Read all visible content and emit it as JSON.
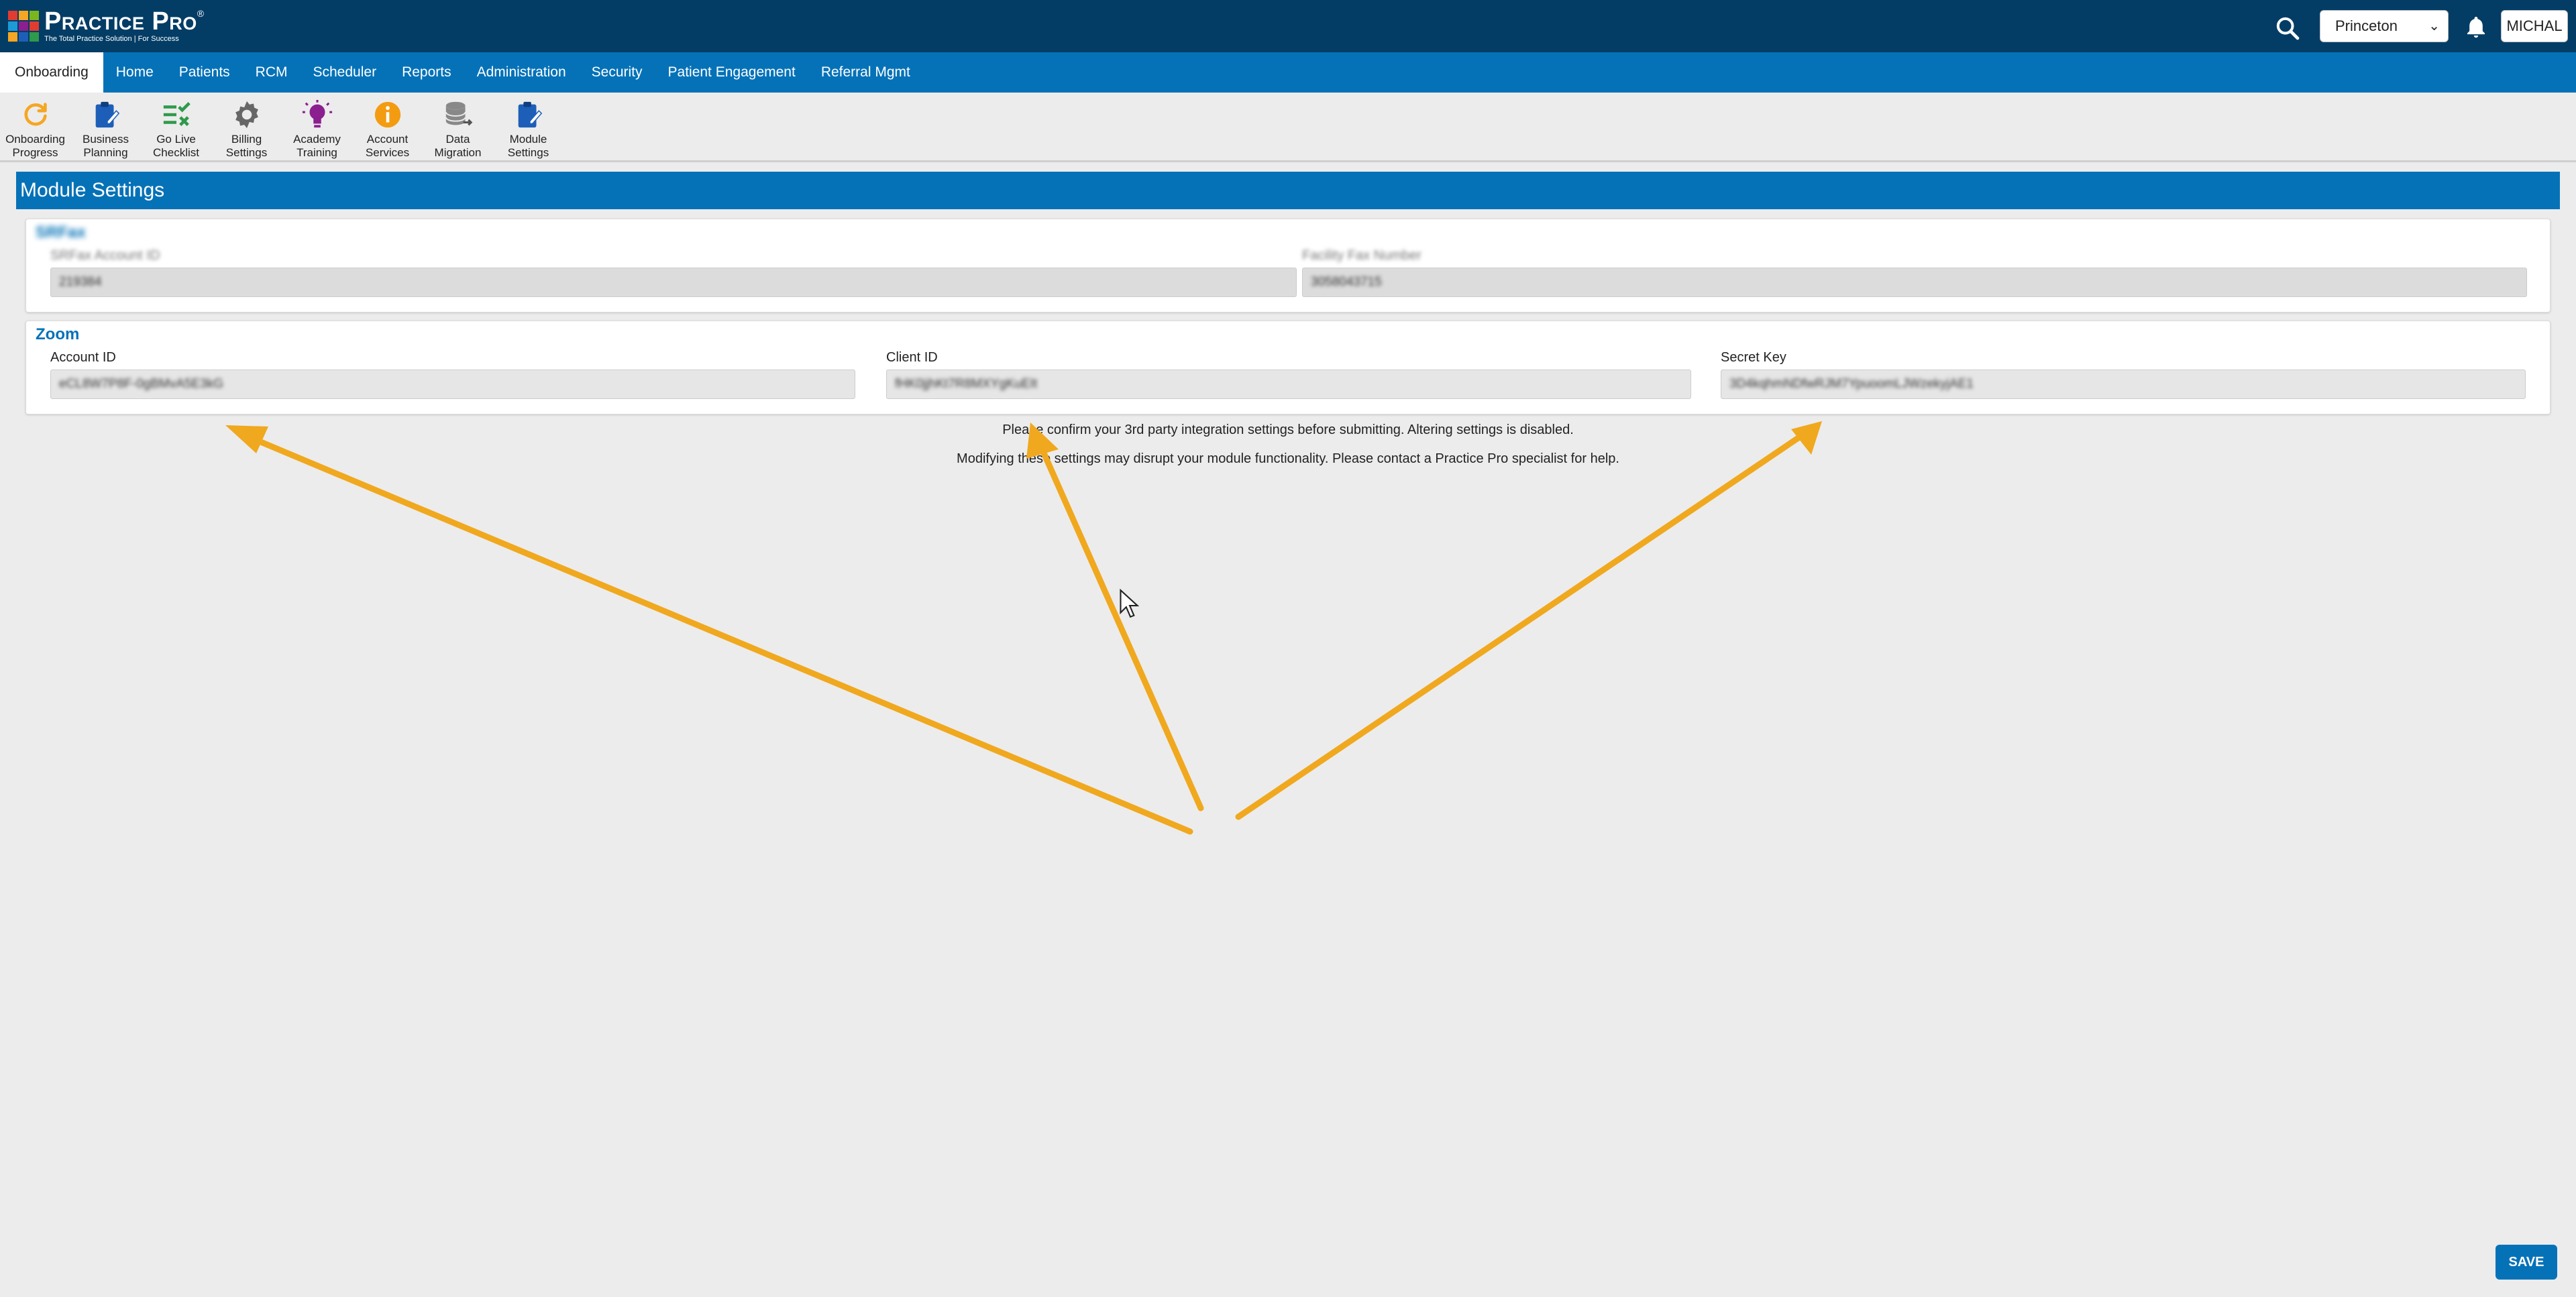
{
  "header": {
    "logo_title": "Practice Pro",
    "logo_trademark": "®",
    "logo_subtitle": "The Total Practice Solution | For Success",
    "location": "Princeton",
    "user": "MICHAL",
    "icons": {
      "search": "search-icon",
      "notifications": "bell-icon",
      "dropdown": "chevron-down-icon"
    }
  },
  "nav": {
    "items": [
      {
        "label": "Onboarding",
        "active": true
      },
      {
        "label": "Home"
      },
      {
        "label": "Patients"
      },
      {
        "label": "RCM"
      },
      {
        "label": "Scheduler"
      },
      {
        "label": "Reports"
      },
      {
        "label": "Administration"
      },
      {
        "label": "Security"
      },
      {
        "label": "Patient Engagement"
      },
      {
        "label": "Referral Mgmt"
      }
    ]
  },
  "subnav": {
    "items": [
      {
        "label1": "Onboarding",
        "label2": "Progress",
        "icon": "refresh-icon",
        "color": "#f5a623"
      },
      {
        "label1": "Business",
        "label2": "Planning",
        "icon": "clipboard-edit-icon",
        "color": "#1d5fb8"
      },
      {
        "label1": "Go Live",
        "label2": "Checklist",
        "icon": "checklist-icon",
        "color": "#2e9a4b"
      },
      {
        "label1": "Billing",
        "label2": "Settings",
        "icon": "gear-icon",
        "color": "#666666"
      },
      {
        "label1": "Academy",
        "label2": "Training",
        "icon": "lightbulb-icon",
        "color": "#8b1f8f"
      },
      {
        "label1": "Account",
        "label2": "Services",
        "icon": "info-icon",
        "color": "#f39c12"
      },
      {
        "label1": "Data",
        "label2": "Migration",
        "icon": "database-icon",
        "color": "#888888"
      },
      {
        "label1": "Module",
        "label2": "Settings",
        "icon": "clipboard-edit-icon",
        "color": "#1d5fb8"
      }
    ]
  },
  "page": {
    "title": "Module Settings"
  },
  "fax_card": {
    "title": "SRFax",
    "account_label": "SRFax Account ID",
    "account_value": "219384",
    "number_label": "Facility Fax Number",
    "number_value": "3058043715"
  },
  "zoom_card": {
    "title": "Zoom",
    "account_label": "Account ID",
    "account_value": "eCL8W7P8F-0gBMvA5E3kG",
    "client_label": "Client ID",
    "client_value": "fHK0jjhKt7R8MXYgKuEIt",
    "secret_label": "Secret Key",
    "secret_value": "3D4kqhmNDfwRJM7YpuoomLJWzekyjAE1"
  },
  "messages": {
    "line1": "Please confirm your 3rd party integration settings before submitting. Altering settings is disabled.",
    "line2": "Modifying these settings may disrupt your module functionality. Please contact a Practice Pro specialist for help."
  },
  "actions": {
    "save": "SAVE"
  },
  "colors": {
    "topbar": "#033d66",
    "nav": "#0572b8",
    "arrow": "#f0a81e"
  }
}
